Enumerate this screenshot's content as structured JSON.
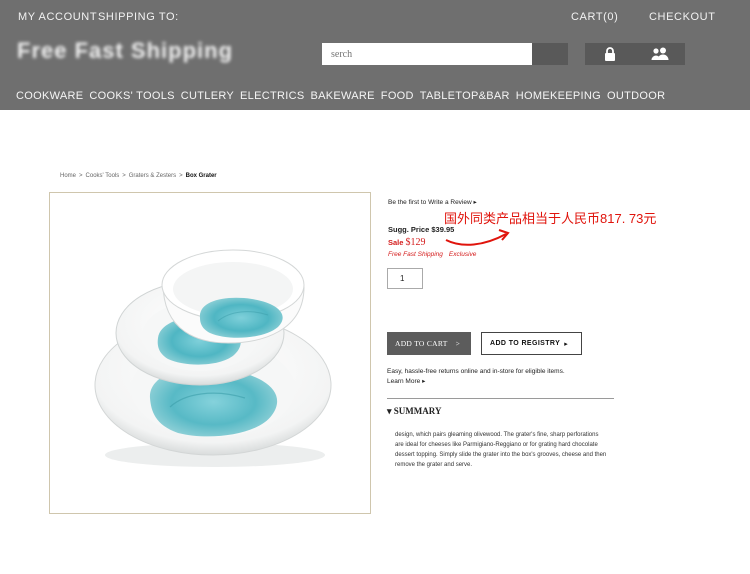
{
  "header": {
    "my_account": "MY ACCOUNT",
    "shipping_to": "SHIPPING TO:",
    "cart": "CART(0)",
    "checkout": "CHECKOUT",
    "logo_text": "Free Fast Shipping",
    "search_placeholder": "serch",
    "lock_icon": "lock-icon",
    "users_icon": "users-icon",
    "background_color": "#6f6f6f"
  },
  "nav": {
    "items": [
      "COOKWARE",
      "COOKS' TOOLS",
      "CUTLERY",
      "ELECTRICS",
      "BAKEWARE",
      "FOOD",
      "TABLETOP&BAR",
      "HOMEKEEPING",
      "OUTDOOR"
    ]
  },
  "breadcrumb": {
    "items": [
      "Home",
      "Cooks' Tools",
      "Graters & Zesters"
    ],
    "separator": ">",
    "current": "Box Grater"
  },
  "product": {
    "review_link": "Be the first to Write a Review",
    "annotation": "国外同类产品相当于人民币817. 73元",
    "sugg_price_label": "Sugg. Price",
    "sugg_price": "$39.95",
    "sale_label": "Sale",
    "sale_price": "$129",
    "free_shipping": "Free Fast Shipping",
    "exclusive": "Exclusive",
    "quantity": "1",
    "add_to_cart": "ADD TO CART",
    "add_to_registry": "ADD TO REGISTRY",
    "returns_text": "Easy, hassle-free returns online and in-store for eligible items.",
    "learn_more": "Learn More",
    "summary_heading": "SUMMARY",
    "summary_text": "design, which pairs gleaming olivewood. The grater's fine, sharp perforations are ideal for cheeses like Parmigiano-Reggiano or for grating hard chocolate dessert topping. Simply slide the grater into the box's grooves, cheese and then remove the grater and serve.",
    "accent_red": "#d41b1b",
    "glaze_color": "#4fb6c3"
  }
}
